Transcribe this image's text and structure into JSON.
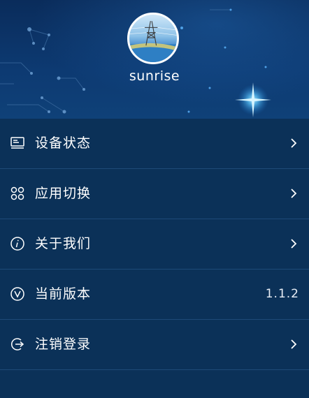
{
  "profile": {
    "username": "sunrise"
  },
  "menu": {
    "items": [
      {
        "label": "设备状态",
        "icon": "monitor-icon",
        "trailing": "chevron"
      },
      {
        "label": "应用切换",
        "icon": "grid-icon",
        "trailing": "chevron"
      },
      {
        "label": "关于我们",
        "icon": "info-icon",
        "trailing": "chevron"
      },
      {
        "label": "当前版本",
        "icon": "version-icon",
        "trailing": "text",
        "value": "1.1.2"
      },
      {
        "label": "注销登录",
        "icon": "logout-icon",
        "trailing": "chevron"
      }
    ]
  },
  "colors": {
    "background": "#0b3158",
    "header_top": "#0a2c5b",
    "divider": "#1e4a78",
    "text": "#ffffff",
    "star": "#8fd8ff"
  }
}
